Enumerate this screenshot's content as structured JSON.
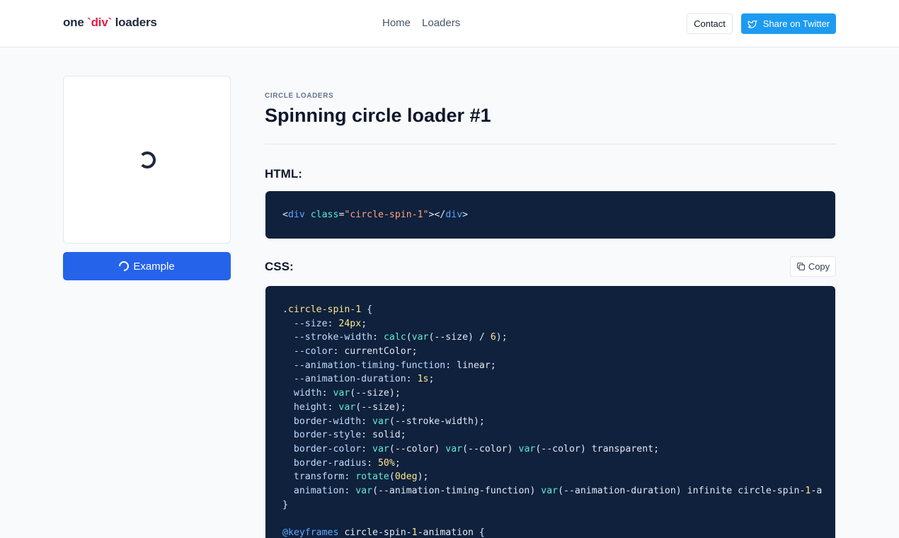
{
  "header": {
    "logo_prefix": "one ",
    "logo_accent": "`div`",
    "logo_suffix": " loaders",
    "nav": [
      {
        "label": "Home"
      },
      {
        "label": "Loaders"
      }
    ],
    "contact_label": "Contact",
    "twitter_label": "Share on Twitter"
  },
  "preview": {
    "example_label": "Example"
  },
  "main": {
    "category": "CIRCLE LOADERS",
    "title": "Spinning circle loader #1",
    "html_heading": "HTML:",
    "css_heading": "CSS:",
    "copy_label": "Copy",
    "html_code": {
      "open": "<",
      "tag": "div",
      "attr": "class",
      "eq": "=",
      "value": "\"circle-spin-1\"",
      "close_mid": "></",
      "tag_close": "div",
      "end": ">"
    },
    "css_lines": [
      [
        {
          "t": ".circle-spin-1",
          "c": "c-sel"
        },
        {
          "t": " {",
          "c": ""
        }
      ],
      [
        {
          "t": "  --size",
          "c": "c-prop"
        },
        {
          "t": ": ",
          "c": ""
        },
        {
          "t": "24px",
          "c": "c-num"
        },
        {
          "t": ";",
          "c": ""
        }
      ],
      [
        {
          "t": "  --stroke-width",
          "c": "c-prop"
        },
        {
          "t": ": ",
          "c": ""
        },
        {
          "t": "calc",
          "c": "c-fn"
        },
        {
          "t": "(",
          "c": ""
        },
        {
          "t": "var",
          "c": "c-fn"
        },
        {
          "t": "(--size) / ",
          "c": ""
        },
        {
          "t": "6",
          "c": "c-num"
        },
        {
          "t": ");",
          "c": ""
        }
      ],
      [
        {
          "t": "  --color",
          "c": "c-prop"
        },
        {
          "t": ": currentColor;",
          "c": ""
        }
      ],
      [
        {
          "t": "  --animation-timing-function",
          "c": "c-prop"
        },
        {
          "t": ": linear;",
          "c": ""
        }
      ],
      [
        {
          "t": "  --animation-duration",
          "c": "c-prop"
        },
        {
          "t": ": ",
          "c": ""
        },
        {
          "t": "1s",
          "c": "c-num"
        },
        {
          "t": ";",
          "c": ""
        }
      ],
      [
        {
          "t": "  width",
          "c": "c-prop"
        },
        {
          "t": ": ",
          "c": ""
        },
        {
          "t": "var",
          "c": "c-fn"
        },
        {
          "t": "(--size);",
          "c": ""
        }
      ],
      [
        {
          "t": "  height",
          "c": "c-prop"
        },
        {
          "t": ": ",
          "c": ""
        },
        {
          "t": "var",
          "c": "c-fn"
        },
        {
          "t": "(--size);",
          "c": ""
        }
      ],
      [
        {
          "t": "  border-width",
          "c": "c-prop"
        },
        {
          "t": ": ",
          "c": ""
        },
        {
          "t": "var",
          "c": "c-fn"
        },
        {
          "t": "(--stroke-width);",
          "c": ""
        }
      ],
      [
        {
          "t": "  border-style",
          "c": "c-prop"
        },
        {
          "t": ": solid;",
          "c": ""
        }
      ],
      [
        {
          "t": "  border-color",
          "c": "c-prop"
        },
        {
          "t": ": ",
          "c": ""
        },
        {
          "t": "var",
          "c": "c-fn"
        },
        {
          "t": "(--color) ",
          "c": ""
        },
        {
          "t": "var",
          "c": "c-fn"
        },
        {
          "t": "(--color) ",
          "c": ""
        },
        {
          "t": "var",
          "c": "c-fn"
        },
        {
          "t": "(--color) transparent;",
          "c": ""
        }
      ],
      [
        {
          "t": "  border-radius",
          "c": "c-prop"
        },
        {
          "t": ": ",
          "c": ""
        },
        {
          "t": "50%",
          "c": "c-num"
        },
        {
          "t": ";",
          "c": ""
        }
      ],
      [
        {
          "t": "  transform",
          "c": "c-prop"
        },
        {
          "t": ": ",
          "c": ""
        },
        {
          "t": "rotate",
          "c": "c-fn"
        },
        {
          "t": "(",
          "c": ""
        },
        {
          "t": "0deg",
          "c": "c-num"
        },
        {
          "t": ");",
          "c": ""
        }
      ],
      [
        {
          "t": "  animation",
          "c": "c-prop"
        },
        {
          "t": ": ",
          "c": ""
        },
        {
          "t": "var",
          "c": "c-fn"
        },
        {
          "t": "(--animation-timing-function) ",
          "c": ""
        },
        {
          "t": "var",
          "c": "c-fn"
        },
        {
          "t": "(--animation-duration) infinite circle-spin-",
          "c": ""
        },
        {
          "t": "1",
          "c": "c-num"
        },
        {
          "t": "-a",
          "c": ""
        }
      ],
      [
        {
          "t": "}",
          "c": ""
        }
      ],
      [
        {
          "t": "",
          "c": ""
        }
      ],
      [
        {
          "t": "@keyframes",
          "c": "c-at"
        },
        {
          "t": " circle-spin-",
          "c": ""
        },
        {
          "t": "1",
          "c": "c-num"
        },
        {
          "t": "-animation {",
          "c": ""
        }
      ]
    ]
  },
  "colors": {
    "accent_blue": "#2563eb",
    "twitter_blue": "#1d9bf0",
    "logo_accent": "#e11d48",
    "code_bg": "#0f213d"
  }
}
